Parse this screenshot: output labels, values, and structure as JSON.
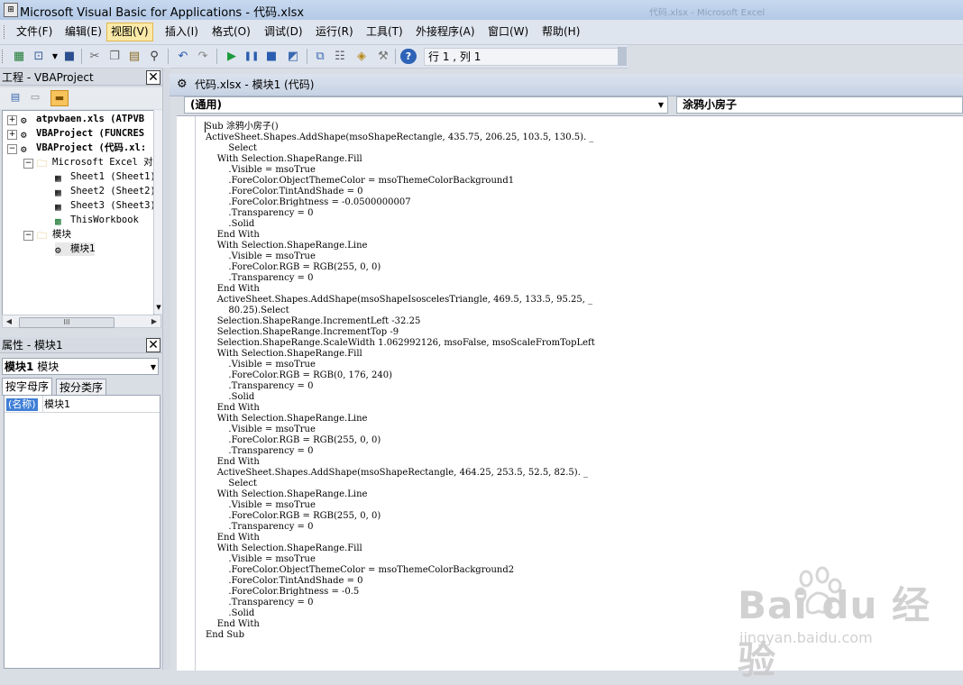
{
  "window": {
    "title": "Microsoft Visual Basic for Applications - 代码.xlsx",
    "background_title": "代码.xlsx - Microsoft Excel"
  },
  "menu": [
    {
      "label": "文件(F)"
    },
    {
      "label": "编辑(E)"
    },
    {
      "label": "视图(V)",
      "active": true
    },
    {
      "label": "插入(I)"
    },
    {
      "label": "格式(O)"
    },
    {
      "label": "调试(D)"
    },
    {
      "label": "运行(R)"
    },
    {
      "label": "工具(T)"
    },
    {
      "label": "外接程序(A)"
    },
    {
      "label": "窗口(W)"
    },
    {
      "label": "帮助(H)"
    }
  ],
  "toolbar": {
    "position_text": "行 1 , 列 1",
    "icons": [
      "view-excel-icon",
      "insert-module-icon",
      "save-icon",
      "cut-icon",
      "copy-icon",
      "paste-icon",
      "find-icon",
      "undo-icon",
      "redo-icon",
      "run-icon",
      "break-icon",
      "reset-icon",
      "design-mode-icon",
      "project-explorer-icon",
      "properties-window-icon",
      "object-browser-icon",
      "toolbox-icon",
      "help-icon"
    ]
  },
  "project_panel": {
    "title": "工程 - VBAProject",
    "tree": {
      "project1": "atpvbaen.xls (ATPVB",
      "project2": "VBAProject (FUNCRES",
      "project3": "VBAProject (代码.xl:",
      "excel_objects_folder": "Microsoft Excel 对象",
      "sheet1": "Sheet1 (Sheet1)",
      "sheet2": "Sheet2 (Sheet2)",
      "sheet3": "Sheet3 (Sheet3)",
      "thisworkbook": "ThisWorkbook",
      "modules_folder": "模块",
      "module1": "模块1"
    }
  },
  "properties_panel": {
    "title": "属性 - 模块1",
    "object_name": "模块1",
    "object_type": "模块",
    "tab_alpha": "按字母序",
    "tab_category": "按分类序",
    "property_name": "(名称)",
    "property_value": "模块1"
  },
  "code_window": {
    "title": "代码.xlsx - 模块1 (代码)",
    "object_combo": "(通用)",
    "procedure_combo": "涂鸦小房子",
    "lines": [
      "Sub 涂鸦小房子()",
      "ActiveSheet.Shapes.AddShape(msoShapeRectangle, 435.75, 206.25, 103.5, 130.5). _",
      "        Select",
      "    With Selection.ShapeRange.Fill",
      "        .Visible = msoTrue",
      "        .ForeColor.ObjectThemeColor = msoThemeColorBackground1",
      "        .ForeColor.TintAndShade = 0",
      "        .ForeColor.Brightness = -0.0500000007",
      "        .Transparency = 0",
      "        .Solid",
      "    End With",
      "    With Selection.ShapeRange.Line",
      "        .Visible = msoTrue",
      "        .ForeColor.RGB = RGB(255, 0, 0)",
      "        .Transparency = 0",
      "    End With",
      "    ActiveSheet.Shapes.AddShape(msoShapeIsoscelesTriangle, 469.5, 133.5, 95.25, _",
      "        80.25).Select",
      "    Selection.ShapeRange.IncrementLeft -32.25",
      "    Selection.ShapeRange.IncrementTop -9",
      "    Selection.ShapeRange.ScaleWidth 1.062992126, msoFalse, msoScaleFromTopLeft",
      "    With Selection.ShapeRange.Fill",
      "        .Visible = msoTrue",
      "        .ForeColor.RGB = RGB(0, 176, 240)",
      "        .Transparency = 0",
      "        .Solid",
      "    End With",
      "    With Selection.ShapeRange.Line",
      "        .Visible = msoTrue",
      "        .ForeColor.RGB = RGB(255, 0, 0)",
      "        .Transparency = 0",
      "    End With",
      "    ActiveSheet.Shapes.AddShape(msoShapeRectangle, 464.25, 253.5, 52.5, 82.5). _",
      "        Select",
      "    With Selection.ShapeRange.Line",
      "        .Visible = msoTrue",
      "        .ForeColor.RGB = RGB(255, 0, 0)",
      "        .Transparency = 0",
      "    End With",
      "    With Selection.ShapeRange.Fill",
      "        .Visible = msoTrue",
      "        .ForeColor.ObjectThemeColor = msoThemeColorBackground2",
      "        .ForeColor.TintAndShade = 0",
      "        .ForeColor.Brightness = -0.5",
      "        .Transparency = 0",
      "        .Solid",
      "    End With",
      "End Sub"
    ]
  },
  "watermark": {
    "brand": "Bai du 经验",
    "url": "jingyan.baidu.com"
  },
  "colors": {
    "selection_blue": "#3f7fd6",
    "menu_active": "#fbe9a7"
  }
}
